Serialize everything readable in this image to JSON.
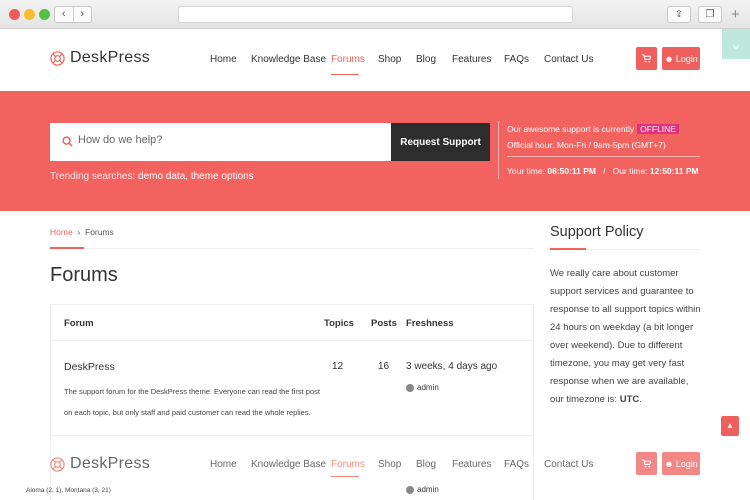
{
  "site": {
    "name": "DeskPress"
  },
  "nav": {
    "items": [
      "Home",
      "Knowledge Base",
      "Forums",
      "Shop",
      "Blog",
      "Features",
      "FAQs",
      "Contact Us"
    ],
    "active": "Forums",
    "login_label": "Login"
  },
  "hero": {
    "search_placeholder": "How do we help?",
    "request_label": "Request Support",
    "trending_label": "Trending searches:",
    "trending_terms": "demo data, theme options",
    "status_text": "Our awesome support is currently",
    "status_badge": "OFFLINE",
    "hours": "Official hour: Mon-Fri / 9am-5pm (GMT+7)",
    "your_time_label": "Your time:",
    "your_time": "06:50:11 PM",
    "separator": "/",
    "our_time_label": "Our time:",
    "our_time": "12:50:11 PM"
  },
  "breadcrumb": {
    "home": "Home",
    "sep": "›",
    "current": "Forums"
  },
  "page": {
    "title": "Forums"
  },
  "table": {
    "headers": {
      "forum": "Forum",
      "topics": "Topics",
      "posts": "Posts",
      "freshness": "Freshness"
    },
    "rows": [
      {
        "name": "DeskPress",
        "description": "The support forum for the DeskPress theme. Everyone can read the first post on each topic, but only staff and paid customer can read the whole replies.",
        "topics": "12",
        "posts": "16",
        "freshness": "3 weeks, 4 days ago",
        "author": "admin"
      }
    ],
    "partial_row": {
      "subforums": "Aloma (2, 1), Montana (3, 21)",
      "author": "admin"
    }
  },
  "sidebar": {
    "title": "Support Policy",
    "text_before": "We really care about customer support services and guarantee to response to all support topics within 24 hours on weekday (a bit longer over weekend). Due to different timezone, you may get very fast response when we are available, our timezone is:",
    "timezone": "UTC",
    "text_after": "."
  },
  "colors": {
    "accent": "#f26360",
    "badge": "#e2317a",
    "dark": "#2d2d2d"
  }
}
